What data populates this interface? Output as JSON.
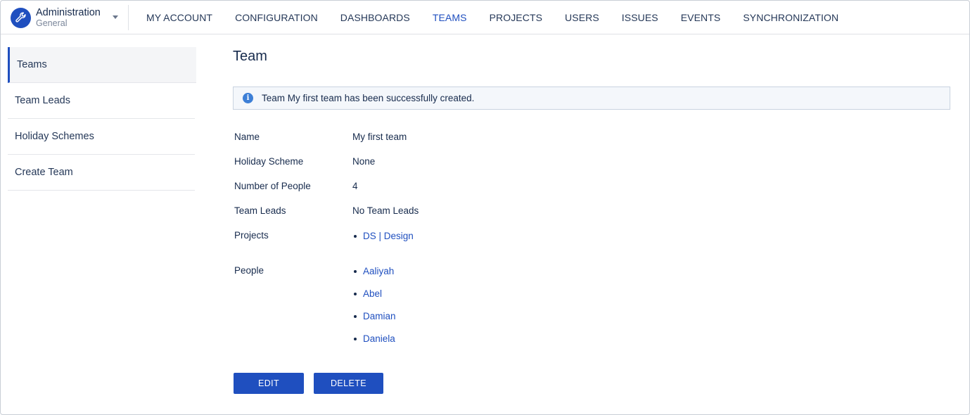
{
  "header": {
    "app_title": "Administration",
    "app_subtitle": "General",
    "app_icon": "wrench-icon",
    "nav": [
      {
        "label": "MY ACCOUNT",
        "active": false
      },
      {
        "label": "CONFIGURATION",
        "active": false
      },
      {
        "label": "DASHBOARDS",
        "active": false
      },
      {
        "label": "TEAMS",
        "active": true
      },
      {
        "label": "PROJECTS",
        "active": false
      },
      {
        "label": "USERS",
        "active": false
      },
      {
        "label": "ISSUES",
        "active": false
      },
      {
        "label": "EVENTS",
        "active": false
      },
      {
        "label": "SYNCHRONIZATION",
        "active": false
      }
    ]
  },
  "sidebar": {
    "items": [
      {
        "label": "Teams",
        "active": true
      },
      {
        "label": "Team Leads",
        "active": false
      },
      {
        "label": "Holiday Schemes",
        "active": false
      },
      {
        "label": "Create Team",
        "active": false
      }
    ]
  },
  "main": {
    "title": "Team",
    "notice": "Team My first team has been successfully created.",
    "fields": {
      "name_label": "Name",
      "name_value": "My first team",
      "holiday_label": "Holiday Scheme",
      "holiday_value": "None",
      "people_count_label": "Number of People",
      "people_count_value": "4",
      "leads_label": "Team Leads",
      "leads_value": "No Team Leads",
      "projects_label": "Projects",
      "projects": [
        "DS | Design"
      ],
      "people_label": "People",
      "people": [
        "Aaliyah",
        "Abel",
        "Damian",
        "Daniela"
      ]
    },
    "buttons": {
      "edit": "EDIT",
      "delete": "DELETE"
    }
  },
  "colors": {
    "accent": "#1f4fbf",
    "notice_bg": "#f4f7fb",
    "info_icon": "#3d7fd6"
  }
}
